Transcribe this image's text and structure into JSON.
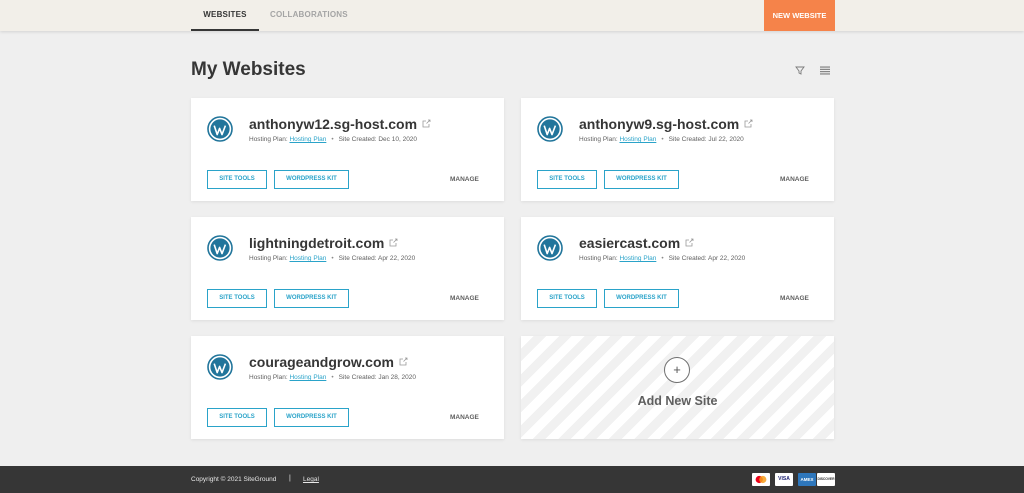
{
  "header": {
    "tabs": [
      {
        "label": "WEBSITES",
        "active": true
      },
      {
        "label": "COLLABORATIONS",
        "active": false
      }
    ],
    "new_website_label": "NEW WEBSITE",
    "accent_color": "#f5834a"
  },
  "main": {
    "title": "My Websites",
    "filter_icon": "filter-icon",
    "view_icon": "list-view-icon"
  },
  "sites": [
    {
      "name": "anthonyw12.sg-host.com",
      "plan_label": "Hosting Plan:",
      "plan": "Hosting Plan",
      "created": "Site Created: Dec 10, 2020"
    },
    {
      "name": "anthonyw9.sg-host.com",
      "plan_label": "Hosting Plan:",
      "plan": "Hosting Plan",
      "created": "Site Created: Jul 22, 2020"
    },
    {
      "name": "lightningdetroit.com",
      "plan_label": "Hosting Plan:",
      "plan": "Hosting Plan",
      "created": "Site Created: Apr 22, 2020"
    },
    {
      "name": "easiercast.com",
      "plan_label": "Hosting Plan:",
      "plan": "Hosting Plan",
      "created": "Site Created: Apr 22, 2020"
    },
    {
      "name": "courageandgrow.com",
      "plan_label": "Hosting Plan:",
      "plan": "Hosting Plan",
      "created": "Site Created: Jan 28, 2020"
    }
  ],
  "card_actions": {
    "site_tools": "SITE TOOLS",
    "wordpress_kit": "WORDPRESS KIT",
    "manage": "MANAGE",
    "link_color": "#2aa3c9"
  },
  "add_site": {
    "plus": "+",
    "label": "Add New Site"
  },
  "footer": {
    "copyright": "Copyright © 2021 SiteGround",
    "separator": "|",
    "legal": "Legal",
    "payment_icons": [
      "mastercard-icon",
      "visa-icon",
      "amex-icon",
      "discover-icon"
    ],
    "payment_labels": [
      "VISA",
      "AMEX",
      "DISCOVER"
    ]
  }
}
